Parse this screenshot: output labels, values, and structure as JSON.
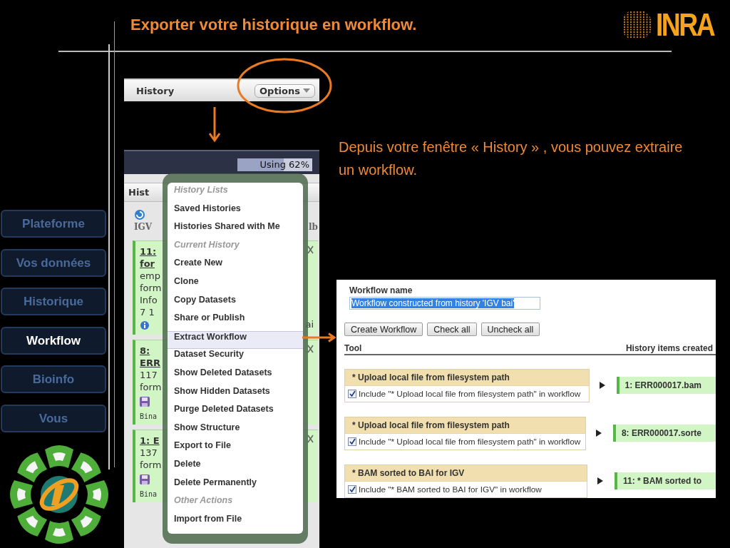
{
  "slide": {
    "title": "Exporter votre historique en workflow.",
    "logo_text": "INRA",
    "caption": "Depuis votre fenêtre « History » , vous pouvez extraire un workflow."
  },
  "history_bar": {
    "title": "History",
    "options_button": "Options"
  },
  "galaxy": {
    "usage": {
      "label": "Using 62%",
      "level": 0.62
    },
    "panel_title": "Hist",
    "history_name": "IGV",
    "history_size": "lb",
    "datasets": [
      {
        "title": [
          "11:",
          "for"
        ],
        "lines": [
          "emp",
          "form",
          "Info",
          "7 1"
        ],
        "side": "ai"
      },
      {
        "title": [
          "8:",
          "ERR"
        ],
        "lines": [
          "117",
          "form"
        ],
        "footer": "Bina"
      },
      {
        "title": [
          "1: E"
        ],
        "lines": [
          "137",
          "form"
        ],
        "footer": "Bina"
      }
    ],
    "menu": [
      {
        "label": "History Lists",
        "kind": "header",
        "selected": false
      },
      {
        "label": "Saved Histories",
        "kind": "item",
        "selected": false
      },
      {
        "label": "Histories Shared with Me",
        "kind": "item",
        "selected": false
      },
      {
        "label": "Current History",
        "kind": "header",
        "selected": false
      },
      {
        "label": "Create New",
        "kind": "item",
        "selected": false
      },
      {
        "label": "Clone",
        "kind": "item",
        "selected": false
      },
      {
        "label": "Copy Datasets",
        "kind": "item",
        "selected": false
      },
      {
        "label": "Share or Publish",
        "kind": "item",
        "selected": false
      },
      {
        "label": "Extract Workflow",
        "kind": "item",
        "selected": true
      },
      {
        "label": "Dataset Security",
        "kind": "item",
        "selected": false
      },
      {
        "label": "Show Deleted Datasets",
        "kind": "item",
        "selected": false
      },
      {
        "label": "Show Hidden Datasets",
        "kind": "item",
        "selected": false
      },
      {
        "label": "Purge Deleted Datasets",
        "kind": "item",
        "selected": false
      },
      {
        "label": "Show Structure",
        "kind": "item",
        "selected": false
      },
      {
        "label": "Export to File",
        "kind": "item",
        "selected": false
      },
      {
        "label": "Delete",
        "kind": "item",
        "selected": false
      },
      {
        "label": "Delete Permanently",
        "kind": "item",
        "selected": false
      },
      {
        "label": "Other Actions",
        "kind": "header",
        "selected": false
      },
      {
        "label": "Import from File",
        "kind": "item",
        "selected": false
      }
    ]
  },
  "extract": {
    "name_label": "Workflow name",
    "name_value": "Workflow constructed from history 'IGV bai'",
    "name_selected": true,
    "buttons": [
      "Create Workflow",
      "Check all",
      "Uncheck all"
    ],
    "columns": [
      "Tool",
      "History items created"
    ],
    "steps": [
      {
        "tool": "* Upload local file from filesystem path",
        "include": "Include \"* Upload local file from filesystem path\" in workflow",
        "checked": true,
        "output": "1: ERR000017.bam"
      },
      {
        "tool": "* Upload local file from filesystem path",
        "include": "Include \"* Upload local file from filesystem path\" in workflow",
        "checked": true,
        "output": "8: ERR000017.sorte"
      },
      {
        "tool": "* BAM sorted to BAI for IGV",
        "include": "Include \"* BAM sorted to BAI for IGV\" in workflow",
        "checked": true,
        "output": "11: * BAM sorted to"
      }
    ]
  },
  "nav": [
    {
      "label": "Plateforme",
      "selected": false
    },
    {
      "label": "Vos données",
      "selected": false
    },
    {
      "label": "Historique",
      "selected": false
    },
    {
      "label": "Workflow",
      "selected": true
    },
    {
      "label": "Bioinfo",
      "selected": false
    },
    {
      "label": "Vous",
      "selected": false
    }
  ]
}
